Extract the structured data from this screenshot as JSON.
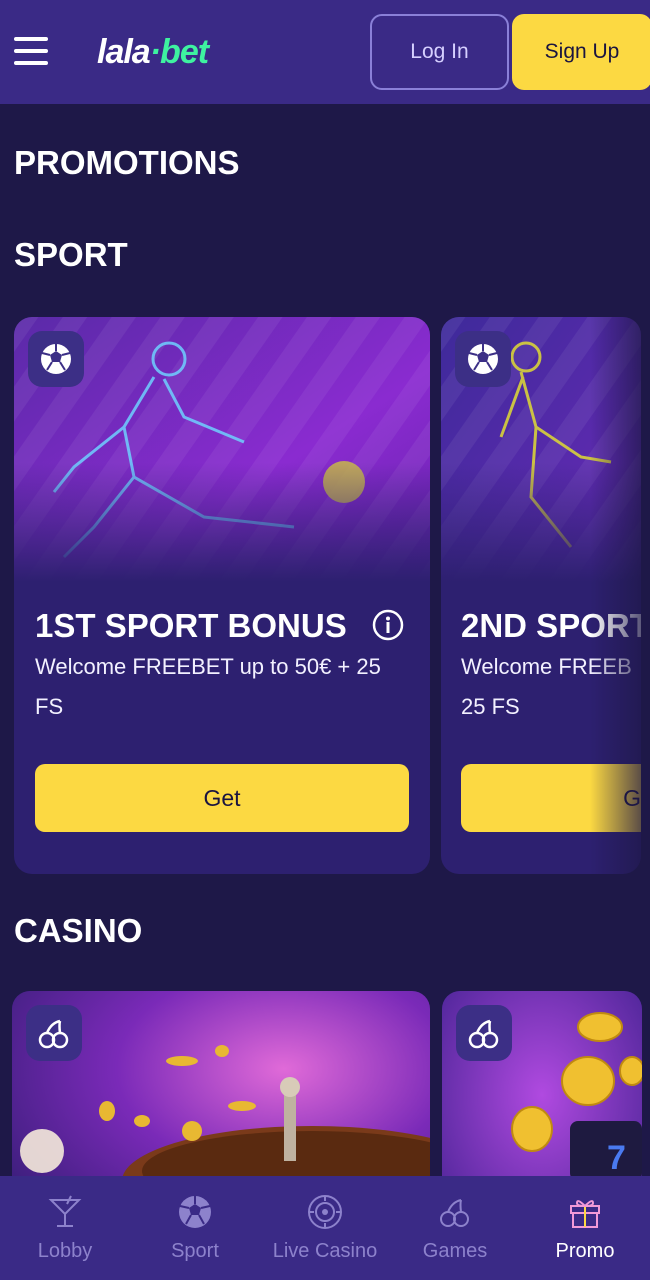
{
  "header": {
    "logo_part1": "lala",
    "logo_dot": "·",
    "logo_part2": "bet",
    "login_label": "Log In",
    "signup_label": "Sign Up"
  },
  "page_title": "PROMOTIONS",
  "sections": {
    "sport": {
      "title": "SPORT",
      "cards": [
        {
          "icon": "soccer-ball-icon",
          "title": "1ST SPORT BONUS",
          "description": "Welcome FREEBET up to 50€ + 25 FS",
          "button": "Get"
        },
        {
          "icon": "soccer-ball-icon",
          "title": "2ND SPORT",
          "description": "Welcome FREEB 25 FS",
          "button": "G"
        }
      ]
    },
    "casino": {
      "title": "CASINO",
      "cards": [
        {
          "icon": "cherries-icon"
        },
        {
          "icon": "cherries-icon"
        }
      ]
    }
  },
  "bottom_nav": {
    "items": [
      {
        "label": "Lobby",
        "icon": "cocktail-icon",
        "active": false
      },
      {
        "label": "Sport",
        "icon": "soccer-ball-icon",
        "active": false
      },
      {
        "label": "Live Casino",
        "icon": "roulette-chip-icon",
        "active": false
      },
      {
        "label": "Games",
        "icon": "cherries-icon",
        "active": false
      },
      {
        "label": "Promo",
        "icon": "gift-icon",
        "active": true
      }
    ]
  },
  "colors": {
    "background": "#1e1848",
    "header": "#3a2a86",
    "card": "#2d2070",
    "accent_yellow": "#fcd942",
    "logo_green": "#3ef2a0",
    "nav_inactive": "#8d82cc"
  }
}
